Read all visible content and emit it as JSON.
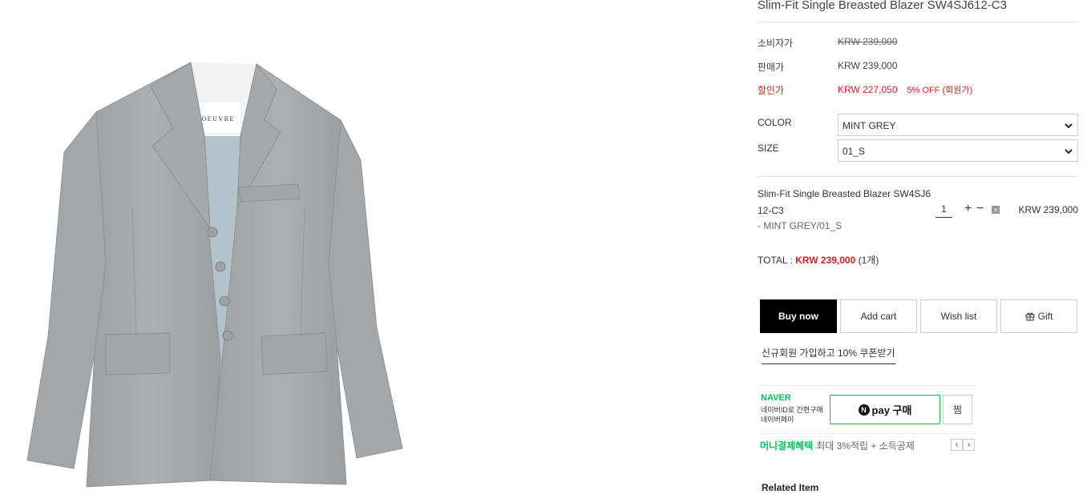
{
  "product": {
    "title": "Slim-Fit Single Breasted Blazer SW4SJ612-C3",
    "label_text": "LOEUVRE"
  },
  "prices": {
    "consumer_label": "소비자가",
    "consumer_value": "KRW 239,000",
    "sale_label": "판매가",
    "sale_value": "KRW 239,000",
    "discount_label": "할인가",
    "discount_value": "KRW 227,050",
    "discount_note": "5% OFF (회원가)"
  },
  "options": {
    "color_label": "COLOR",
    "color_value": "MINT GREY",
    "size_label": "SIZE",
    "size_value": "01_S"
  },
  "line_item": {
    "name_line1": "Slim-Fit Single Breasted Blazer SW4SJ6",
    "name_line2": "12-C3",
    "option": "- MINT GREY/01_S",
    "quantity": "1",
    "plus": "+",
    "minus": "−",
    "delete": "×",
    "price": "KRW 239,000"
  },
  "total": {
    "label": "TOTAL : ",
    "value": "KRW 239,000",
    "count": "(1개)"
  },
  "buttons": {
    "buy_now": "Buy now",
    "add_cart": "Add cart",
    "wish_list": "Wish list",
    "gift": "Gift"
  },
  "coupon_link": "신규회원 가입하고 10% 쿠폰받기",
  "naver": {
    "brand": "NAVER",
    "desc_line1": "네이버ID로 간편구매",
    "desc_line2": "네이버페이",
    "pay_n": "N",
    "pay_label": "pay 구매",
    "zzim_label": "찜",
    "benefit_title": "머니결제혜택",
    "benefit_desc": "최대 3%적립 + 소득공제",
    "prev": "‹",
    "next": "›"
  },
  "related_title": "Related Item",
  "colors": {
    "discount_red": "#e02020",
    "naver_green": "#03c75a",
    "blazer_grey": "#a7abae",
    "lining_blue": "#b3c3cc",
    "primary_button": "#000000"
  },
  "icons": {
    "select_chevron": "chevron-down-icon",
    "gift": "gift-icon",
    "delete": "close-icon"
  }
}
